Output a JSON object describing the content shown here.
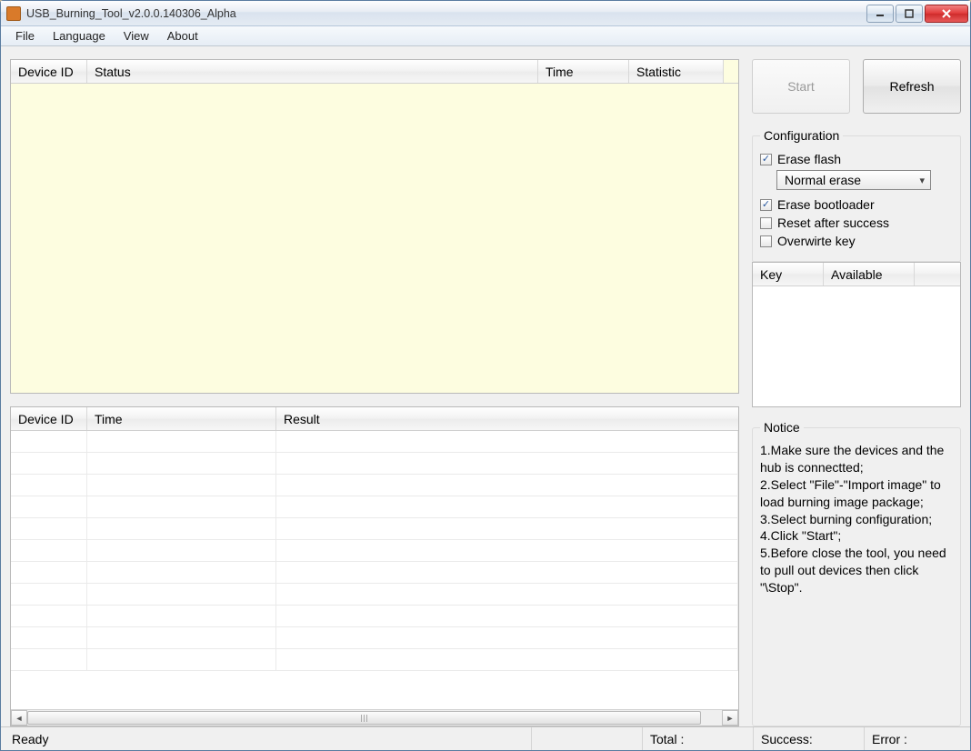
{
  "window": {
    "title": "USB_Burning_Tool_v2.0.0.140306_Alpha"
  },
  "menu": {
    "file": "File",
    "language": "Language",
    "view": "View",
    "about": "About"
  },
  "upperTable": {
    "cols": {
      "device_id": "Device ID",
      "status": "Status",
      "time": "Time",
      "statistic": "Statistic"
    }
  },
  "lowerTable": {
    "cols": {
      "device_id": "Device ID",
      "time": "Time",
      "result": "Result"
    }
  },
  "buttons": {
    "start": "Start",
    "refresh": "Refresh"
  },
  "config": {
    "legend": "Configuration",
    "erase_flash": "Erase flash",
    "erase_mode_selected": "Normal erase",
    "erase_bootloader": "Erase bootloader",
    "reset_after": "Reset after success",
    "overwrite_key": "Overwirte key"
  },
  "keyTable": {
    "cols": {
      "key": "Key",
      "available": "Available"
    }
  },
  "notice": {
    "legend": "Notice",
    "text": "1.Make sure the devices and the hub is connectted;\n2.Select \"File\"-\"Import image\" to load burning image package;\n3.Select burning configuration;\n4.Click \"Start\";\n5.Before close the tool, you need to pull out devices then click \"\\Stop\"."
  },
  "status": {
    "ready": "Ready",
    "total": "Total :",
    "success": "Success:",
    "error": "Error :"
  }
}
